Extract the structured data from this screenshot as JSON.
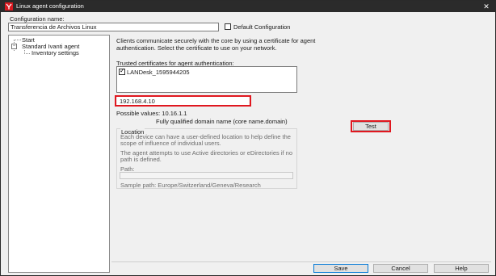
{
  "window": {
    "title": "Linux agent configuration",
    "close_glyph": "✕"
  },
  "config_name": {
    "label": "Configuration name:",
    "value": "Transferencia de Archivos Linux"
  },
  "default_config": {
    "label": "Default Configuration",
    "checked": false
  },
  "tree": {
    "items": [
      {
        "label": "Start"
      },
      {
        "label": "Standard Ivanti agent"
      },
      {
        "label": "Inventory settings"
      }
    ]
  },
  "description": {
    "line1": "Clients communicate securely with the core by using a certificate for agent",
    "line2": "authentication. Select the certificate to use on your network."
  },
  "trusted_certs": {
    "label": "Trusted certificates for agent authentication:",
    "items": [
      {
        "label": "LANDesk_1595944205",
        "checked": true
      }
    ]
  },
  "core": {
    "value": "192.168.4.10",
    "possible_values": "Possible values: 10.16.1.1",
    "fqdn_hint": "Fully qualified domain name (core name.domain)",
    "test_label": "Test"
  },
  "location": {
    "title": "Location",
    "text1_line1": "Each device can have a user-defined location to help define the",
    "text1_line2": "scope of influence of individual users.",
    "text2_line1": "The agent attempts to use Active directories or eDirectories if no",
    "text2_line2": "path is defined.",
    "path_label": "Path:",
    "path_value": "",
    "sample": "Sample path: Europe/Switzerland/Geneva/Research"
  },
  "buttons": {
    "save": "Save",
    "cancel": "Cancel",
    "help": "Help"
  },
  "colors": {
    "highlight": "#e0171f",
    "titlebar": "#2b2b2b",
    "window_bg": "#f0f0f0"
  }
}
